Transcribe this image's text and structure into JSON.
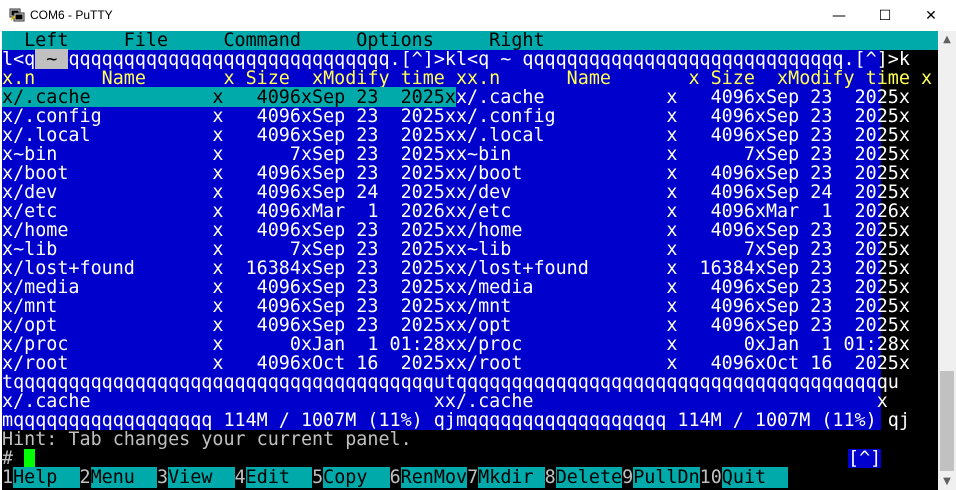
{
  "window": {
    "title": "COM6 - PuTTY",
    "buttons": {
      "minimize": "—",
      "maximize": "☐",
      "close": "✕"
    }
  },
  "colors": {
    "blue": "#0000cc",
    "cyan": "#00aaaa",
    "yellow": "#ffff55",
    "white": "#ffffff",
    "black": "#000000",
    "gray": "#c0c0c0",
    "green": "#00ff00"
  },
  "menubar": "  Left     File     Command     Options     Right                                                  ",
  "panel_top": {
    "left": "l<q",
    "tilde": " ~ ",
    "mid": "qqqqqqqqqqqqqqqqqqqqqqqqqqqqq.[^]>kl<q ~ qqqqqqqqqqqqqqqqqqqqqqqqqqqqq.[^]>k"
  },
  "panel_header": "x.n      Name       x Size  xModify time xx.n      Name       x Size  xModify time x",
  "selected_row": "x/.cache           x   4096xSep 23  2025x",
  "rows": [
    "x/.cache           x   4096xSep 23  2025x",
    "x/.config          x   4096xSep 23  2025xx/.config          x   4096xSep 23  2025x",
    "x/.local           x   4096xSep 23  2025xx/.local           x   4096xSep 23  2025x",
    "x~bin              x      7xSep 23  2025xx~bin              x      7xSep 23  2025x",
    "x/boot             x   4096xSep 23  2025xx/boot             x   4096xSep 23  2025x",
    "x/dev              x   4096xSep 24  2025xx/dev              x   4096xSep 24  2025x",
    "x/etc              x   4096xMar  1  2026xx/etc              x   4096xMar  1  2026x",
    "x/home             x   4096xSep 23  2025xx/home             x   4096xSep 23  2025x",
    "x~lib              x      7xSep 23  2025xx~lib              x      7xSep 23  2025x",
    "x/lost+found       x  16384xSep 23  2025xx/lost+found       x  16384xSep 23  2025x",
    "x/media            x   4096xSep 23  2025xx/media            x   4096xSep 23  2025x",
    "x/mnt              x   4096xSep 23  2025xx/mnt              x   4096xSep 23  2025x",
    "x/opt              x   4096xSep 23  2025xx/opt              x   4096xSep 23  2025x",
    "x/proc             x      0xJan  1 01:28xx/proc             x      0xJan  1 01:28x",
    "x/root             x   4096xOct 16  2025xx/root             x   4096xOct 16  2025x"
  ],
  "right_first_row": "x/.cache           x   4096xSep 23  2025x",
  "separator": "tqqqqqqqqqqqqqqqqqqqqqqqqqqqqqqqqqqqqqqutqqqqqqqqqqqqqqqqqqqqqqqqqqqqqqqqqqqqqqqu",
  "mini_status": "x/.cache                               xx/.cache                               x",
  "bottom_border": "mqqqqqqqqqqqqqqqqqq 114M / 1007M (11%) qjmqqqqqqqqqqqqqqqqqq 114M / 1007M (11%) qj",
  "hint": "Hint: Tab changes your current panel.",
  "prompt": "#",
  "prompt_tag": "[^]",
  "fkeys": [
    {
      "num": "1",
      "label": "Help  "
    },
    {
      "num": "2",
      "label": "Menu  "
    },
    {
      "num": "3",
      "label": "View  "
    },
    {
      "num": "4",
      "label": "Edit  "
    },
    {
      "num": "5",
      "label": "Copy  "
    },
    {
      "num": "6",
      "label": "RenMov"
    },
    {
      "num": "7",
      "label": "Mkdir "
    },
    {
      "num": "8",
      "label": "Delete"
    },
    {
      "num": "9",
      "label": "PullDn"
    },
    {
      "num": "10",
      "label": "Quit  "
    }
  ]
}
